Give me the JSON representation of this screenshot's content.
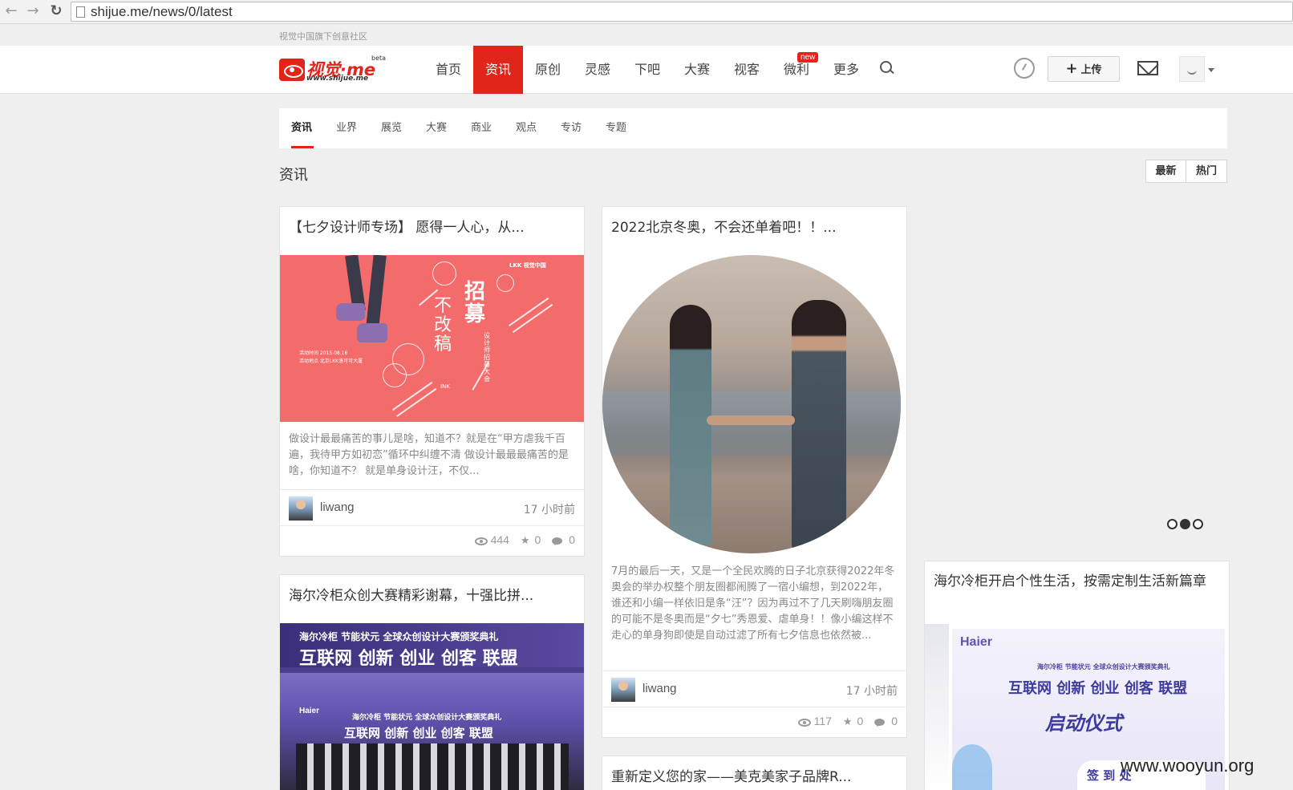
{
  "browser": {
    "url": "shijue.me/news/0/latest",
    "back_icon": "back-arrow-icon",
    "forward_icon": "forward-arrow-icon",
    "reload_icon": "reload-icon"
  },
  "site": {
    "slogan": "视觉中国旗下创意社区",
    "logo_name": "视觉·me",
    "logo_url": "www.shijue.me",
    "logo_beta": "beta",
    "brand_color": "#e1251b"
  },
  "mainnav": {
    "items": [
      {
        "label": "首页",
        "active": false
      },
      {
        "label": "资讯",
        "active": true
      },
      {
        "label": "原创",
        "active": false
      },
      {
        "label": "灵感",
        "active": false
      },
      {
        "label": "下吧",
        "active": false
      },
      {
        "label": "大赛",
        "active": false
      },
      {
        "label": "视客",
        "active": false
      },
      {
        "label": "微利",
        "active": false
      },
      {
        "label": "更多",
        "active": false
      }
    ],
    "new_badge": "new",
    "upload_label": "上传"
  },
  "subnav": {
    "items": [
      "资讯",
      "业界",
      "展览",
      "大赛",
      "商业",
      "观点",
      "专访",
      "专题"
    ],
    "active_index": 0
  },
  "section": {
    "title": "资讯",
    "sort_latest": "最新",
    "sort_hot": "热门"
  },
  "cards": [
    {
      "title": "【七夕设计师专场】 愿得一人心，从...",
      "summary": "做设计最最痛苦的事儿是啥，知道不？就是在“甲方虐我千百遍，我待甲方如初恋”循环中纠缠不清 做设计最最最痛苦的是啥，你知道不？ 就是单身设计汪，不仅...",
      "author": "liwang",
      "time": "17 小时前",
      "views": "444",
      "favorites": "0",
      "comments": "0",
      "poster": {
        "headline_1": "招募",
        "headline_2": "不改稿",
        "side_text": "设计师招募大会",
        "brand": "LKK  视觉中国",
        "info_1": "活动时间   2015.08.16",
        "info_2": "活动地点   北京LKK洛可可大厦",
        "ink": "INK"
      }
    },
    {
      "title": "2022北京冬奥，不会还单着吧！！...",
      "summary": "7月的最后一天，又是一个全民欢腾的日子北京获得2022年冬奥会的举办权整个朋友圈都闹腾了一宿小编想，到2022年，谁还和小编一样依旧是条“汪”？因为再过不了几天刷嗨朋友圈的可能不是冬奥而是“夕七”秀恩爱、虐单身！！像小编这样不走心的单身狗即使是自动过滤了所有七夕信息也依然被...",
      "author": "liwang",
      "time": "17 小时前",
      "views": "117",
      "favorites": "0",
      "comments": "0"
    },
    {
      "title": "海尔冷柜众创大赛精彩谢幕，十强比拼...",
      "stage": {
        "line_1": "海尔冷柜  节能状元  全球众创设计大赛颁奖典礼",
        "line_2": "互联网 创新 创业 创客 联盟",
        "small_1": "海尔冷柜 节能状元 全球众创设计大赛颁奖典礼",
        "small_2": "互联网 创新 创业 创客 联盟",
        "brand": "Haier"
      }
    },
    {
      "title": "重新定义您的家——美克美家子品牌R..."
    },
    {
      "title": "海尔冷柜开启个性生活，按需定制生活新篇章",
      "banner": {
        "brand": "Haier",
        "line_1": "海尔冷柜 节能状元 全球众创设计大赛颁奖典礼",
        "line_2": "互联网 创新 创业 创客 联盟",
        "line_3": "启动仪式",
        "line_4": "签 到 处"
      }
    }
  ],
  "pager": {
    "count": 3,
    "active": 1
  },
  "watermark": "www.wooyun.org"
}
